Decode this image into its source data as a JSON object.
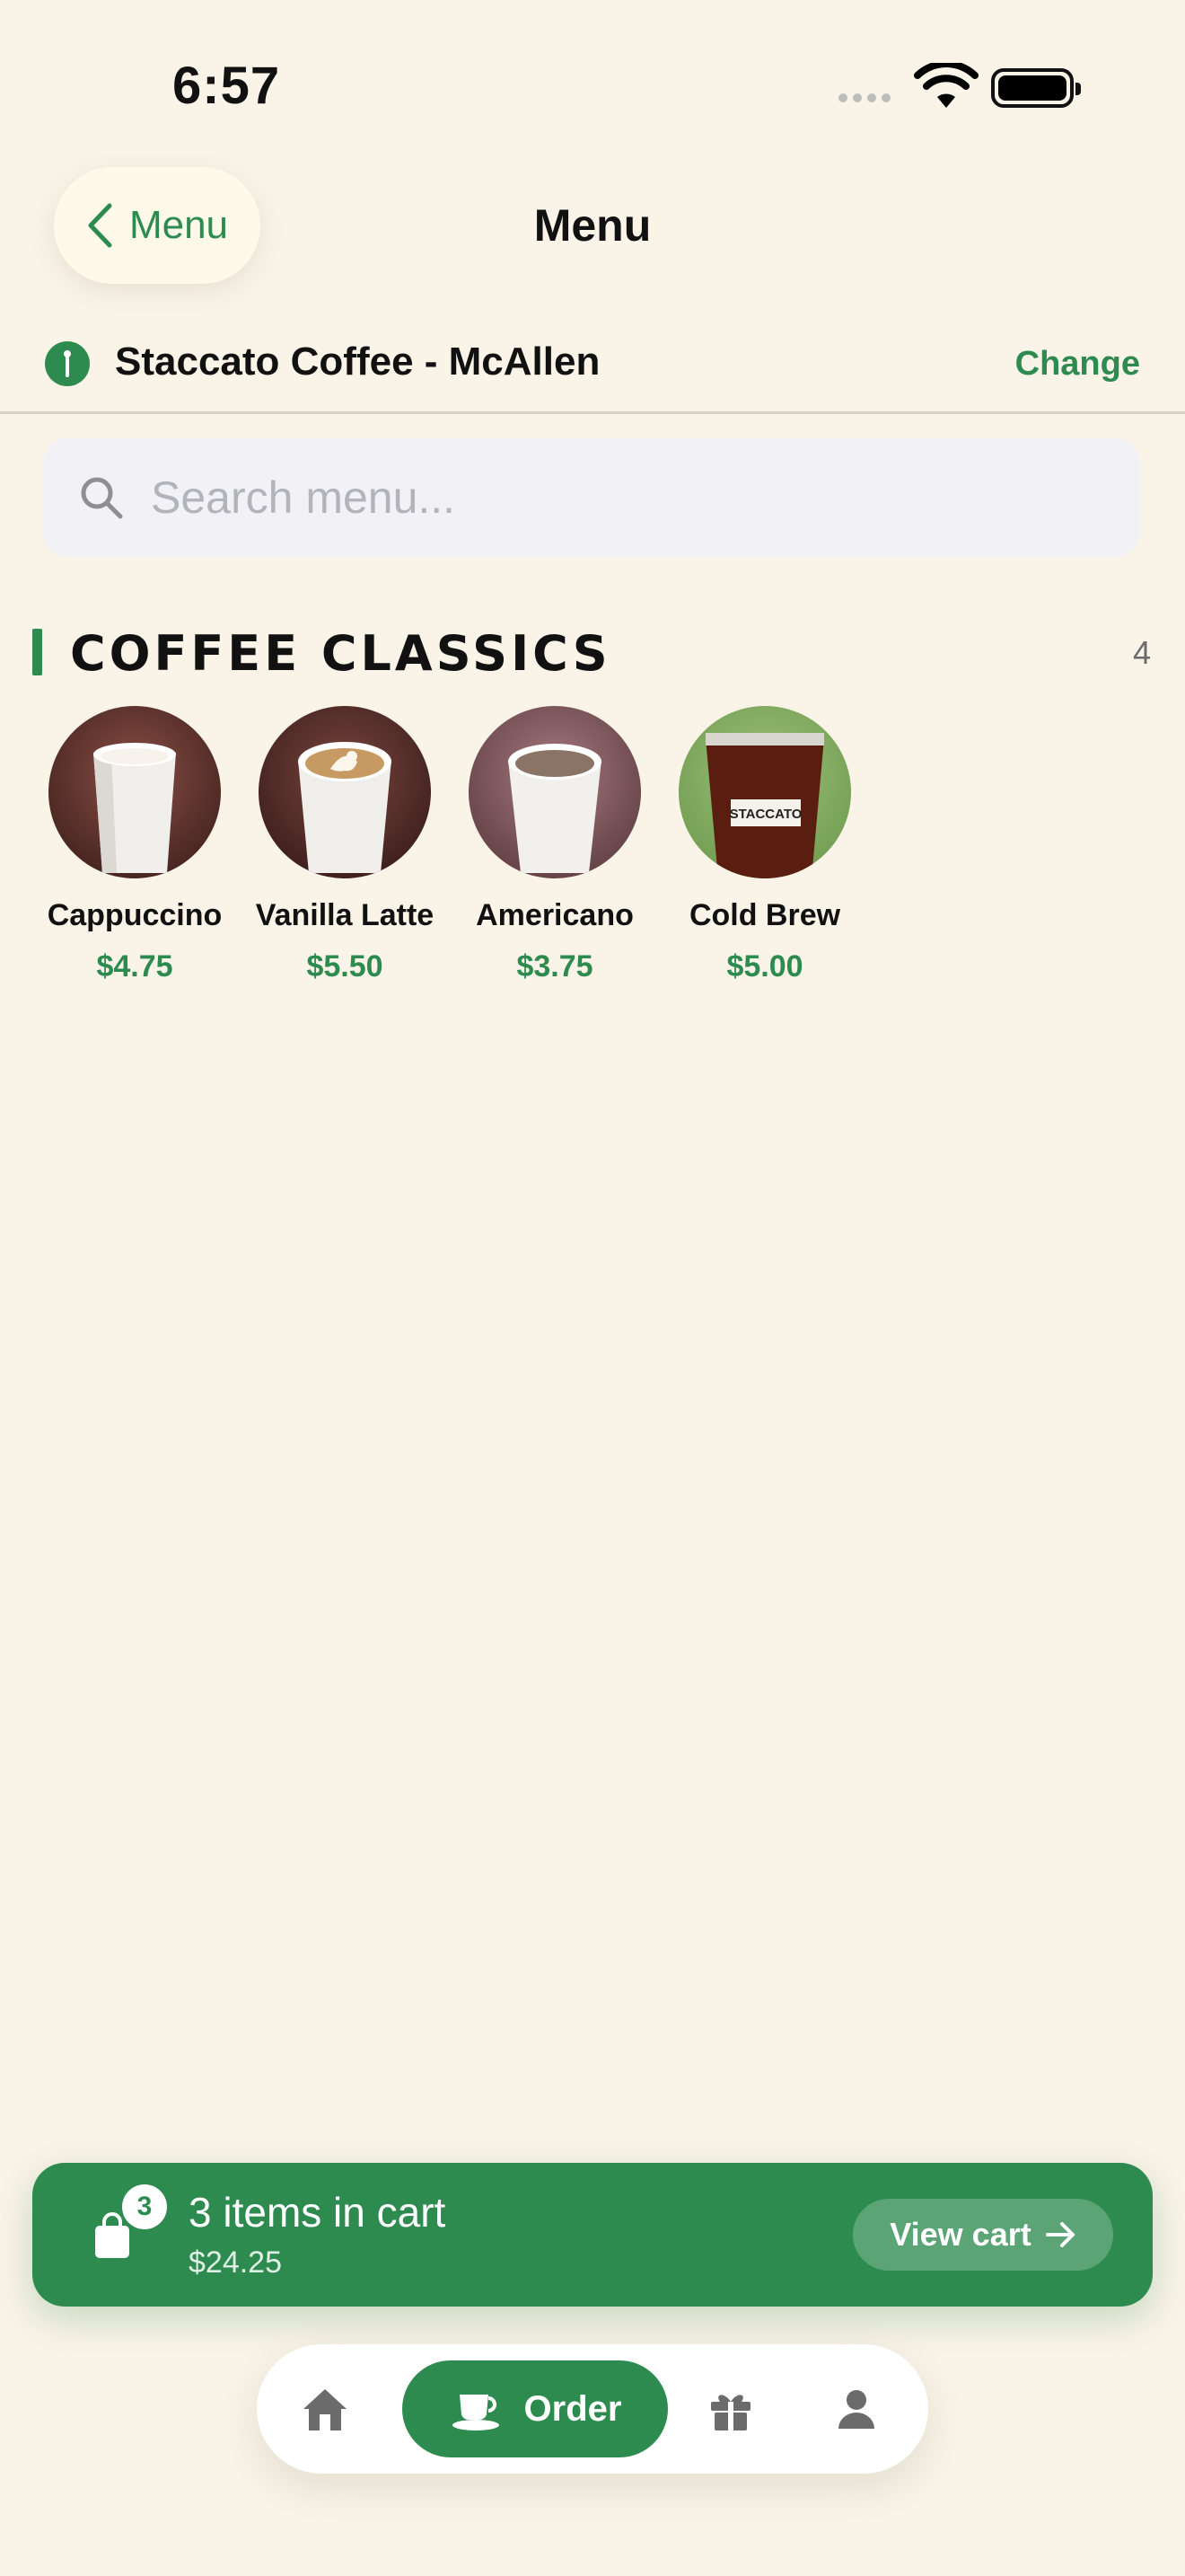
{
  "status": {
    "time": "6:57"
  },
  "nav": {
    "back_label": "Menu",
    "title": "Menu"
  },
  "location": {
    "name": "Staccato Coffee - McAllen",
    "change_label": "Change"
  },
  "search": {
    "placeholder": "Search menu..."
  },
  "section": {
    "title": "COFFEE CLASSICS",
    "count": "4",
    "items": [
      {
        "name": "Cappuccino",
        "price": "$4.75",
        "photo": "hot-cup-white-foam"
      },
      {
        "name": "Vanilla Latte",
        "price": "$5.50",
        "photo": "hot-cup-latte-art"
      },
      {
        "name": "Americano",
        "price": "$3.75",
        "photo": "hot-cup-dark"
      },
      {
        "name": "Cold Brew",
        "price": "$5.00",
        "photo": "iced-cup-staccato",
        "label_text": "STACCATO"
      }
    ]
  },
  "cart": {
    "badge": "3",
    "title": "3 items in cart",
    "total": "$24.25",
    "view_label": "View cart"
  },
  "tabbar": {
    "tabs": [
      {
        "icon": "home-icon"
      },
      {
        "icon": "coffee-cup-icon",
        "label": "Order",
        "active": true
      },
      {
        "icon": "gift-icon"
      },
      {
        "icon": "profile-icon"
      }
    ]
  },
  "colors": {
    "accent": "#2e8b50",
    "background": "#f9f3e8"
  }
}
